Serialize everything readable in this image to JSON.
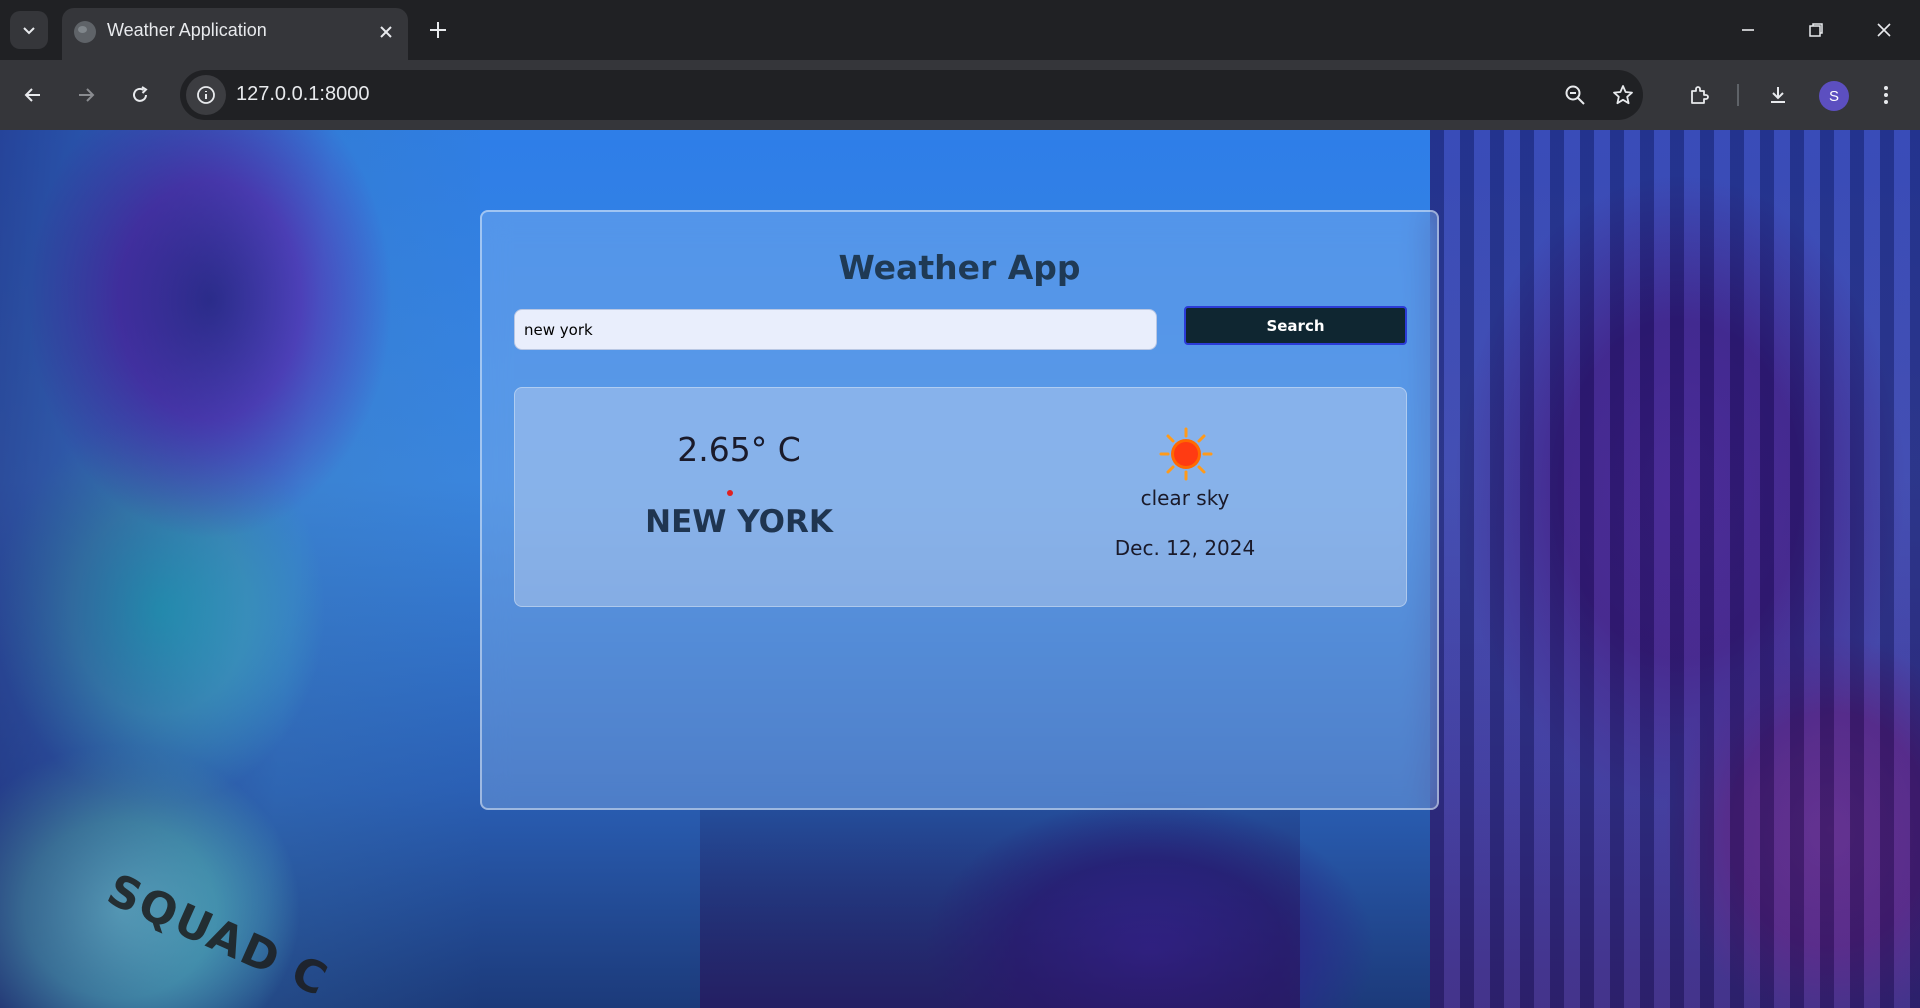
{
  "browser": {
    "tab": {
      "title": "Weather Application"
    },
    "address_bar": {
      "url": "127.0.0.1:8000"
    },
    "profile_initial": "S"
  },
  "app": {
    "title": "Weather App",
    "search": {
      "value": "new york",
      "button_label": "Search"
    },
    "result": {
      "temperature": "2.65° C",
      "city": "NEW YORK",
      "condition": "clear sky",
      "date": "Dec. 12, 2024",
      "weather_icon": "sun-icon"
    }
  },
  "background": {
    "sign_text": "SQUAD C"
  },
  "colors": {
    "search_button_bg": "#0f2631",
    "search_button_border": "#2b3bd6",
    "title_color": "#1f3a55",
    "sun_color": "#ff3b12"
  }
}
